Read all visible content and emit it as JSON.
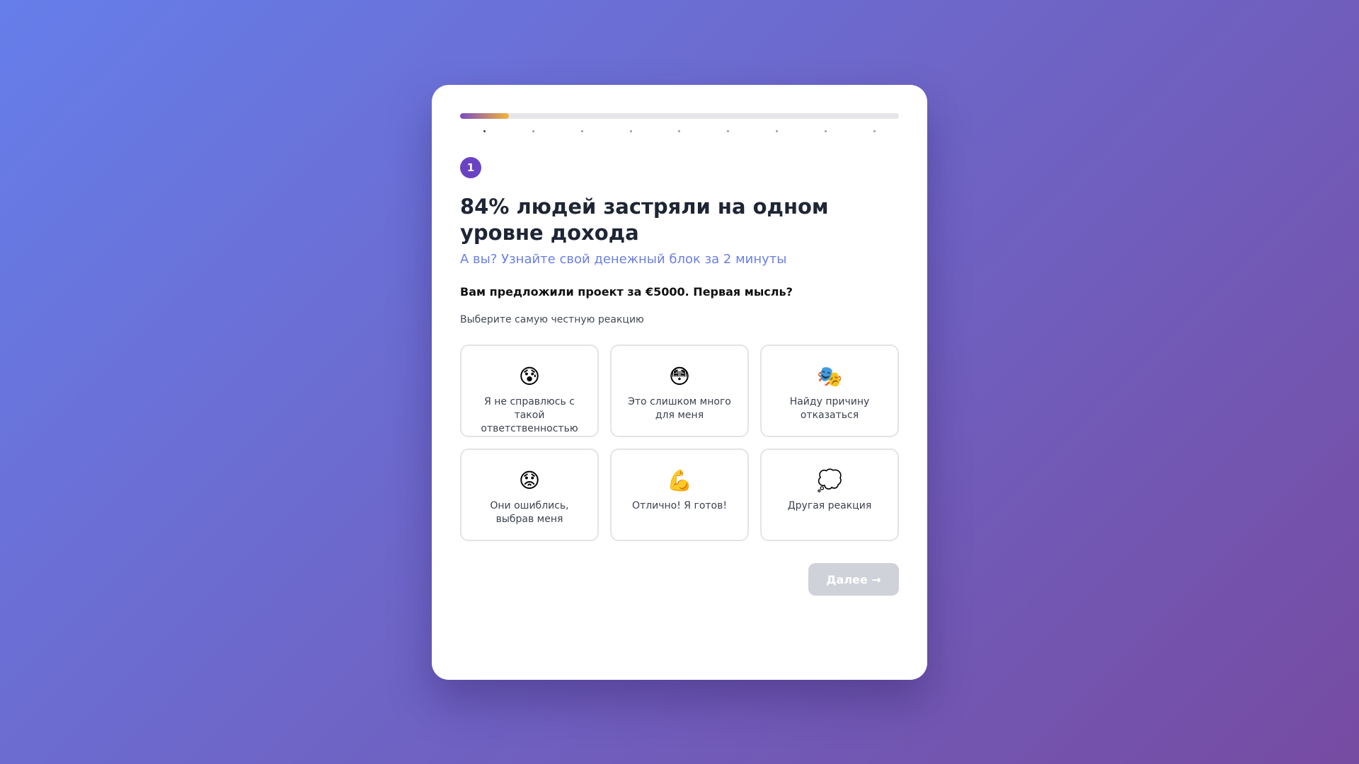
{
  "quiz": {
    "progress": 0.111,
    "total_steps": 9,
    "current_step": 1,
    "step_badge": "1",
    "title": "84% людей застряли на одном уровне дохода",
    "subtitle": "А вы? Узнайте свой денежный блок за 2 минуты",
    "question": "Вам предложили проект за €5000. Первая мысль?",
    "hint": "Выберите самую честную реакцию",
    "options": [
      {
        "icon": "😰",
        "icon_name": "anxious-face-icon",
        "label": "Я не справлюсь с такой ответственностью"
      },
      {
        "icon": "😳",
        "icon_name": "flushed-face-icon",
        "label": "Это слишком много для меня"
      },
      {
        "icon": "🎭",
        "icon_name": "theater-masks-icon",
        "label": "Найду причину отказаться"
      },
      {
        "icon": "😟",
        "icon_name": "worried-face-icon",
        "label": "Они ошиблись, выбрав меня"
      },
      {
        "icon": "💪",
        "icon_name": "flexed-biceps-icon",
        "label": "Отлично! Я готов!"
      },
      {
        "icon": "💭",
        "icon_name": "thought-bubble-icon",
        "label": "Другая реакция"
      }
    ],
    "next_label": "Далее →"
  },
  "colors": {
    "background_start": "#667eea",
    "background_end": "#764ba2",
    "accent": "#6a43c2",
    "subtitle": "#6b7fe0",
    "progress_start": "#7b4bc4",
    "progress_end": "#f3b43a",
    "disabled_button": "#cfd2d8"
  }
}
